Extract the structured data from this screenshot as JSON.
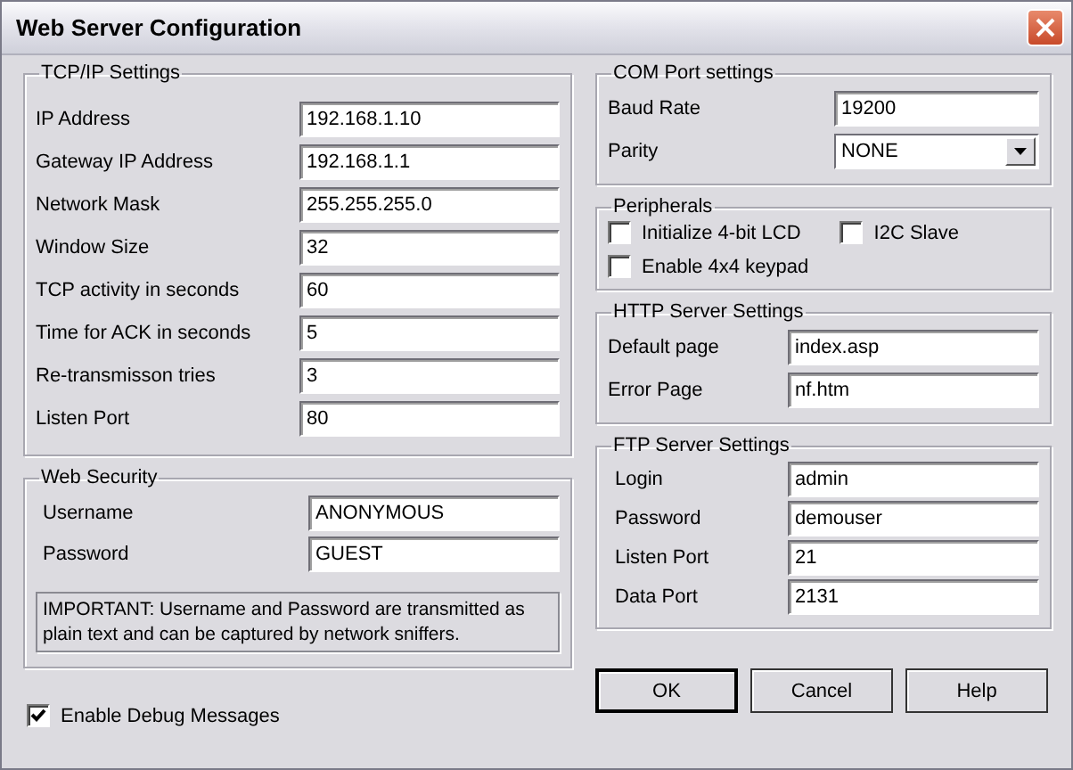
{
  "window": {
    "title": "Web Server Configuration"
  },
  "tcp_ip_settings": {
    "title": "TCP/IP Settings",
    "fields": [
      {
        "label": "IP Address",
        "value": "192.168.1.10"
      },
      {
        "label": "Gateway IP Address",
        "value": "192.168.1.1"
      },
      {
        "label": "Network Mask",
        "value": "255.255.255.0"
      },
      {
        "label": "Window Size",
        "value": "32"
      },
      {
        "label": "TCP activity in seconds",
        "value": "60"
      },
      {
        "label": "Time for ACK in seconds",
        "value": "5"
      },
      {
        "label": "Re-transmisson tries",
        "value": "3"
      },
      {
        "label": "Listen Port",
        "value": "80"
      }
    ]
  },
  "web_security": {
    "title": "Web Security",
    "fields": [
      {
        "label": "Username",
        "value": "ANONYMOUS"
      },
      {
        "label": "Password",
        "value": "GUEST"
      }
    ],
    "notice": "IMPORTANT: Username and Password are transmitted as plain text and can be captured by network sniffers."
  },
  "debug": {
    "label": "Enable Debug Messages",
    "checked": true
  },
  "com_port": {
    "title": "COM Port settings",
    "baud_rate": {
      "label": "Baud Rate",
      "value": "19200"
    },
    "parity": {
      "label": "Parity",
      "value": "NONE"
    }
  },
  "peripherals": {
    "title": "Peripherals",
    "options": [
      {
        "label": "Initialize 4-bit LCD",
        "checked": false
      },
      {
        "label": "I2C Slave",
        "checked": false
      },
      {
        "label": "Enable 4x4 keypad",
        "checked": false
      }
    ]
  },
  "http_server": {
    "title": "HTTP Server Settings",
    "fields": [
      {
        "label": "Default page",
        "value": "index.asp"
      },
      {
        "label": "Error Page",
        "value": "nf.htm"
      }
    ]
  },
  "ftp_server": {
    "title": "FTP Server Settings",
    "fields": [
      {
        "label": "Login",
        "value": "admin"
      },
      {
        "label": "Password",
        "value": "demouser"
      },
      {
        "label": "Listen Port",
        "value": "21"
      },
      {
        "label": "Data Port",
        "value": "2131"
      }
    ]
  },
  "buttons": [
    {
      "label": "OK",
      "default": true
    },
    {
      "label": "Cancel",
      "default": false
    },
    {
      "label": "Help",
      "default": false
    }
  ]
}
